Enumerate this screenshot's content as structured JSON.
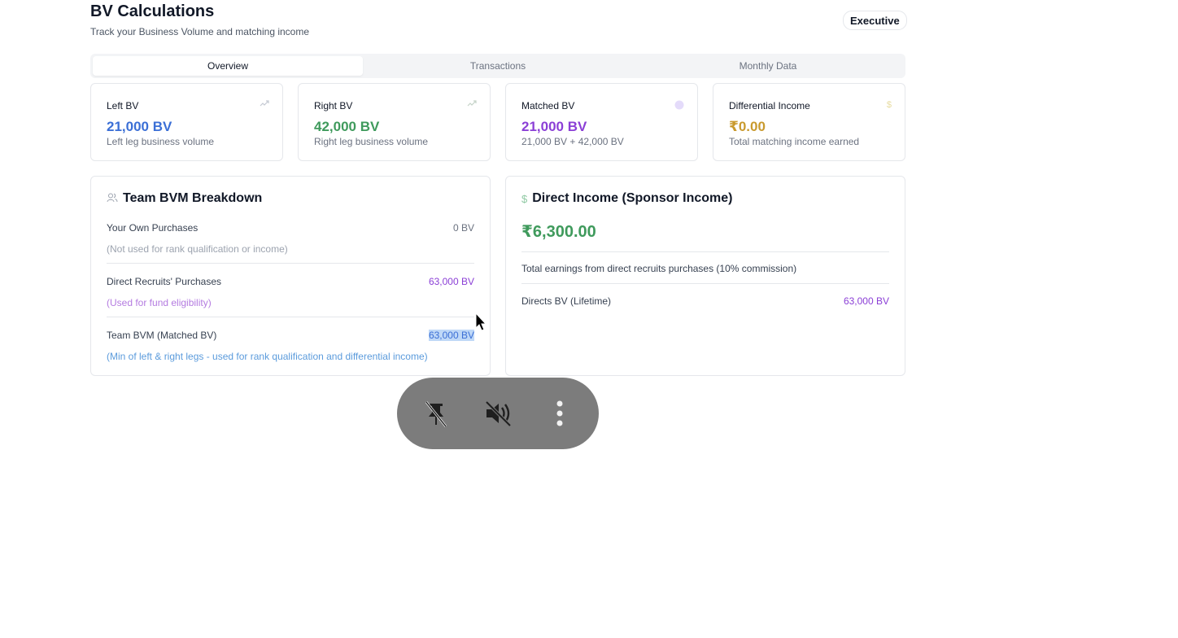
{
  "header": {
    "title": "BV Calculations",
    "subtitle": "Track your Business Volume and matching income",
    "rank_badge": "Executive"
  },
  "tabs": [
    {
      "label": "Overview",
      "active": true
    },
    {
      "label": "Transactions",
      "active": false
    },
    {
      "label": "Monthly Data",
      "active": false
    }
  ],
  "stats": [
    {
      "title": "Left BV",
      "value": "21,000 BV",
      "desc": "Left leg business volume",
      "color": "#3b6fd6",
      "icon": "trending-up-icon"
    },
    {
      "title": "Right BV",
      "value": "42,000 BV",
      "desc": "Right leg business volume",
      "color": "#3f9a5c",
      "icon": "trending-up-icon"
    },
    {
      "title": "Matched BV",
      "value": "21,000 BV",
      "desc": "21,000 BV + 42,000 BV",
      "color": "#8b3fd6",
      "icon": "circle-icon"
    },
    {
      "title": "Differential Income",
      "value": "₹0.00",
      "desc": "Total matching income earned",
      "color": "#c99a2e",
      "icon": "dollar-icon"
    }
  ],
  "team_breakdown": {
    "title": "Team BVM Breakdown",
    "rows": [
      {
        "label": "Your Own Purchases",
        "value": "0 BV",
        "note": "(Not used for rank qualification or income)",
        "value_color": "#6b7280",
        "note_color": "#9ca3af"
      },
      {
        "label": "Direct Recruits' Purchases",
        "value": "63,000 BV",
        "note": "(Used for fund eligibility)",
        "value_color": "#8b3fd6",
        "note_color": "#b47be0"
      },
      {
        "label": "Team BVM (Matched BV)",
        "value": "63,000 BV",
        "note": "(Min of left & right legs - used for rank qualification and differential income)",
        "value_color": "#3b6fd6",
        "note_color": "#5b9bdc"
      }
    ]
  },
  "direct_income": {
    "title": "Direct Income (Sponsor Income)",
    "amount": "₹6,300.00",
    "description": "Total earnings from direct recruits purchases (10% commission)",
    "lifetime_label": "Directs BV (Lifetime)",
    "lifetime_value": "63,000 BV",
    "amount_color": "#3f9a5c"
  },
  "overlay_controls": [
    "unpin-icon",
    "muted-icon",
    "more-vertical-icon"
  ]
}
